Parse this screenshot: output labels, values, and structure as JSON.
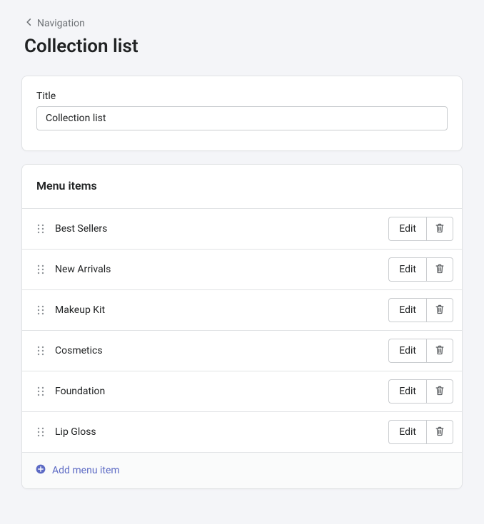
{
  "breadcrumb": {
    "label": "Navigation"
  },
  "page": {
    "title": "Collection list"
  },
  "title_field": {
    "label": "Title",
    "value": "Collection list"
  },
  "menu": {
    "header": "Menu items",
    "edit_label": "Edit",
    "add_label": "Add menu item",
    "items": [
      {
        "label": "Best Sellers"
      },
      {
        "label": "New Arrivals"
      },
      {
        "label": "Makeup Kit"
      },
      {
        "label": "Cosmetics"
      },
      {
        "label": "Foundation"
      },
      {
        "label": "Lip Gloss"
      }
    ]
  },
  "colors": {
    "accent": "#5c6ac4"
  }
}
